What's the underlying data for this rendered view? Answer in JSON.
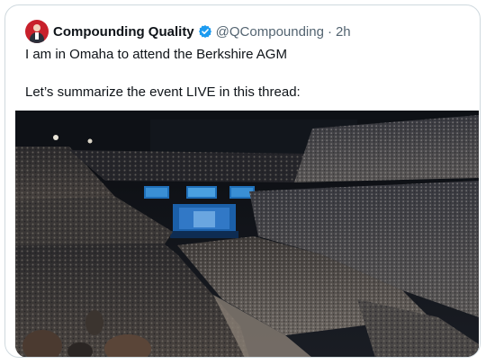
{
  "tweet": {
    "author_name": "Compounding Quality",
    "handle": "@QCompounding",
    "separator": "·",
    "timestamp": "2h",
    "lines": [
      "I am in Omaha to attend the Berkshire AGM",
      "Let’s summarize the event LIVE in this thread:"
    ]
  },
  "colors": {
    "verified_badge": "#1d9bf0",
    "avatar_bg": "#c8202b",
    "text_primary": "#0f1419",
    "text_secondary": "#536471",
    "card_border": "#cfd9de"
  },
  "icons": {
    "verified": "verified-badge-icon",
    "avatar": "profile-avatar"
  }
}
